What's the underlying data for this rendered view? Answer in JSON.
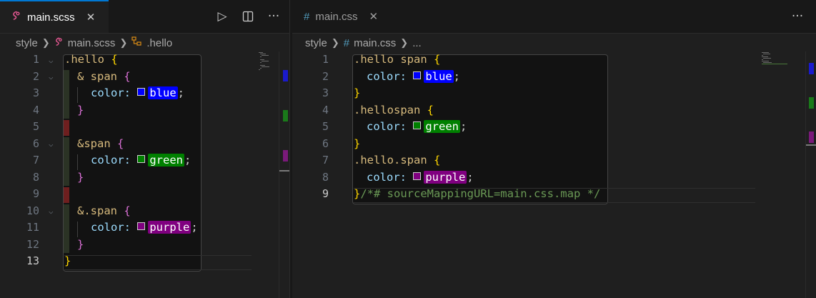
{
  "left": {
    "tab": {
      "icon": "sass-icon",
      "label": "main.scss",
      "close": "✕"
    },
    "actions": {
      "run": "▷",
      "split": "◫",
      "more": "···"
    },
    "breadcrumb": {
      "folder": "style",
      "file": "main.scss",
      "symbol": ".hello"
    },
    "line_numbers": [
      "1",
      "2",
      "3",
      "4",
      "5",
      "6",
      "7",
      "8",
      "9",
      "10",
      "11",
      "12",
      "13"
    ],
    "code": {
      "l1_sel": ".hello",
      "l1_brace": "{",
      "l2_amp": "& span",
      "l2_brace": "{",
      "l3_prop": "color:",
      "l3_val": "blue",
      "l3_semi": ";",
      "l4_brace": "}",
      "l6_amp": "&span",
      "l6_brace": "{",
      "l7_prop": "color:",
      "l7_val": "green",
      "l7_semi": ";",
      "l8_brace": "}",
      "l10_amp": "&.span",
      "l10_brace": "{",
      "l11_prop": "color:",
      "l11_val": "purple",
      "l11_semi": ";",
      "l12_brace": "}",
      "l13_brace": "}"
    }
  },
  "right": {
    "tab": {
      "icon": "#",
      "label": "main.css",
      "close": "✕"
    },
    "actions": {
      "more": "···"
    },
    "breadcrumb": {
      "folder": "style",
      "file_icon": "#",
      "file": "main.css",
      "more": "..."
    },
    "line_numbers": [
      "1",
      "2",
      "3",
      "4",
      "5",
      "6",
      "7",
      "8",
      "9"
    ],
    "code": {
      "l1_sel": ".hello span",
      "l1_brace": "{",
      "l2_prop": "color:",
      "l2_val": "blue",
      "l2_semi": ";",
      "l3_brace": "}",
      "l4_sel": ".hellospan",
      "l4_brace": "{",
      "l5_prop": "color:",
      "l5_val": "green",
      "l5_semi": ";",
      "l6_brace": "}",
      "l7_sel": ".hello.span",
      "l7_brace": "{",
      "l8_prop": "color:",
      "l8_val": "purple",
      "l8_semi": ";",
      "l9_brace": "}",
      "l9_comment": "/*# sourceMappingURL=main.css.map */"
    }
  },
  "colors": {
    "blue": "#0000ff",
    "green": "#008000",
    "purple": "#800080",
    "accent": "#0078d4"
  }
}
